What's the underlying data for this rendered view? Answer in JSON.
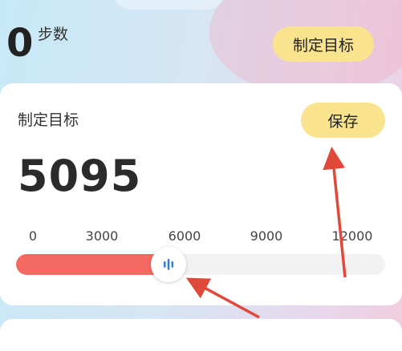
{
  "header": {
    "steps_value": "0",
    "steps_label": "步数",
    "set_goal_label": "制定目标"
  },
  "goal_card": {
    "title": "制定目标",
    "save_label": "保存",
    "goal_value": "5095",
    "slider": {
      "min": 0,
      "max": 12000,
      "value": 5095,
      "ticks": [
        "0",
        "3000",
        "6000",
        "9000",
        "12000"
      ],
      "fill_color": "#f46a62",
      "handle_icon": "grip-lines-icon"
    }
  },
  "colors": {
    "accent_button": "#f9e38f",
    "annotation_arrow": "#e0483a"
  }
}
